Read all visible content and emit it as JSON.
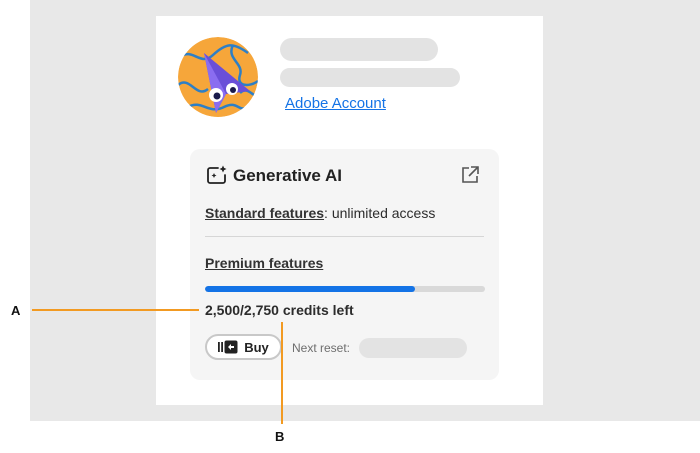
{
  "account": {
    "link_label": "Adobe Account",
    "avatar_icon": "purple-cursor-character-icon"
  },
  "generative_ai": {
    "title": "Generative AI",
    "icon": "sparkle-frame-icon",
    "external_icon": "open-external-icon",
    "standard_label": "Standard features",
    "standard_value": ": unlimited access",
    "premium_label": "Premium features",
    "credits_text": "2,500/2,750 credits left",
    "credits_used_fraction": 0.75,
    "buy_label": "Buy",
    "buy_icon": "credits-buy-icon",
    "next_reset_label": "Next reset:"
  },
  "callouts": {
    "a": "A",
    "b": "B"
  },
  "colors": {
    "accent": "#1473e6",
    "callout": "#f29a22",
    "avatar_bg": "#f6a63a",
    "avatar_character": "#6a4fd8"
  }
}
